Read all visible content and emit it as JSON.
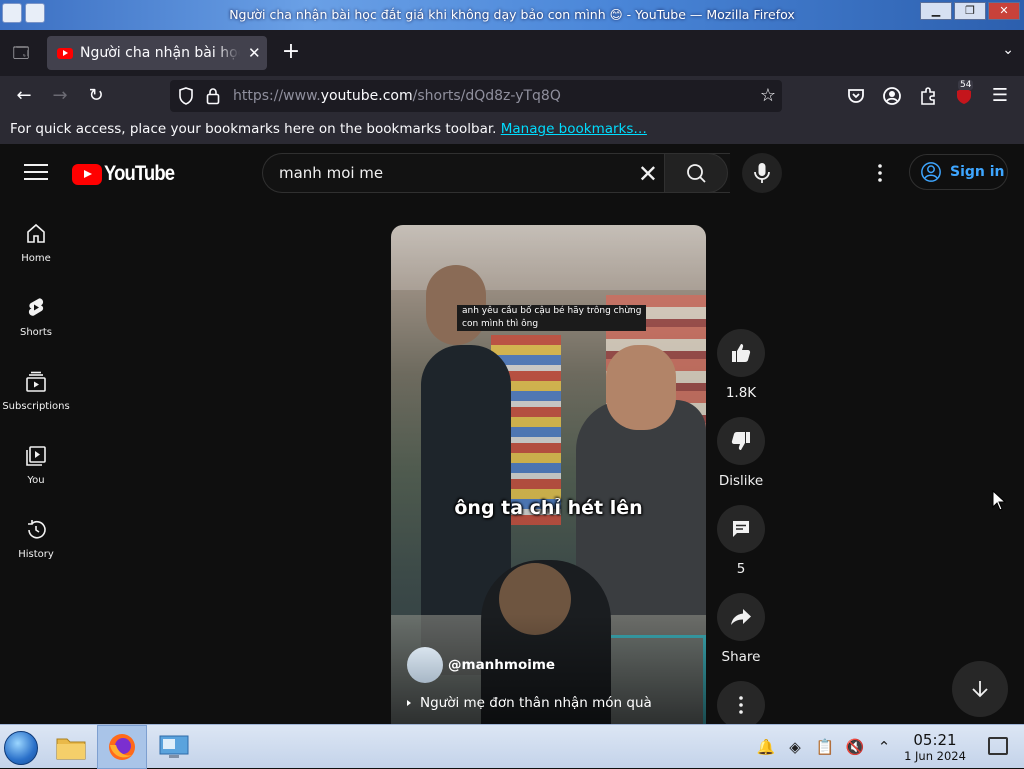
{
  "window": {
    "title": "Người cha nhận bài học đắt giá khi không dạy bảo con mình 😊 - YouTube — Mozilla Firefox"
  },
  "browser": {
    "tab_label": "Người cha nhận bài học đắt giá khi không dạy bảo con mình",
    "url_prefix": "https://www.",
    "url_domain": "youtube.com",
    "url_path": "/shorts/dQd8z-yTq8Q",
    "extension_badge": "54",
    "bookmarks_message": "For quick access, place your bookmarks here on the bookmarks toolbar.",
    "bookmarks_link": "Manage bookmarks…"
  },
  "youtube": {
    "logo_text": "YouTube",
    "search_query": "manh moi me",
    "sign_in": "Sign in",
    "sidebar": [
      {
        "label": "Home",
        "icon": "home-icon"
      },
      {
        "label": "Shorts",
        "icon": "shorts-icon"
      },
      {
        "label": "Subscriptions",
        "icon": "subscriptions-icon"
      },
      {
        "label": "You",
        "icon": "you-icon"
      },
      {
        "label": "History",
        "icon": "history-icon"
      }
    ],
    "short": {
      "caption_line1": "anh yêu cầu bố cậu bé hãy trông chừng",
      "caption_line2": "con mình thì ông",
      "subtitle": "ông ta chỉ hét lên",
      "channel": "@manhmoime",
      "title": "Người mẹ đơn thân nhận món quà"
    },
    "actions": {
      "like_count": "1.8K",
      "dislike_label": "Dislike",
      "comment_count": "5",
      "share_label": "Share"
    }
  },
  "taskbar": {
    "time": "05:21",
    "date": "1 Jun 2024"
  },
  "colors": {
    "youtube_red": "#ff0000",
    "sign_in_blue": "#3ea6ff",
    "link_cyan": "#00ddff"
  }
}
